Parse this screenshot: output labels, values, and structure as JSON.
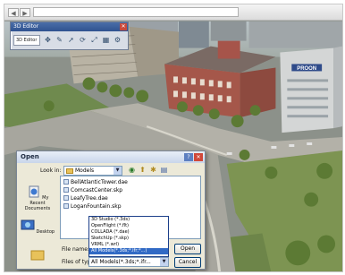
{
  "browser": {
    "back_glyph": "◀",
    "forward_glyph": "▶"
  },
  "editor": {
    "title": "3D Editor",
    "dropdown": "3D Editor",
    "close_glyph": "✕",
    "tools": [
      "move-icon",
      "pencil-icon",
      "pointer-icon",
      "rotate-icon",
      "scale-icon",
      "grid-icon",
      "settings-icon"
    ]
  },
  "dialog": {
    "title": "Open",
    "look_in_label": "Look in:",
    "look_in_value": "Models",
    "places": [
      {
        "label": "My Recent Documents",
        "icon": "recent-documents-icon"
      },
      {
        "label": "Desktop",
        "icon": "desktop-icon"
      }
    ],
    "files": [
      "BellAtlanticTower.dae",
      "ComcastCenter.skp",
      "LeafyTree.dae",
      "LoganFountain.skp"
    ],
    "file_name_label": "File name:",
    "files_of_type_label": "Files of type:",
    "files_of_type_value": "All Models(*.3ds;*.ifr...",
    "type_options": [
      "3D Studio (*.3ds)",
      "OpenFlight (*.flt)",
      "COLLADA (*.dae)",
      "SketchUp (*.skp)",
      "VRML (*.wrl)",
      "All Models(*.3ds;*.ifr;*...)"
    ],
    "open_button": "Open",
    "cancel_button": "Cancel"
  },
  "scene": {
    "sign_text": "PROON"
  }
}
